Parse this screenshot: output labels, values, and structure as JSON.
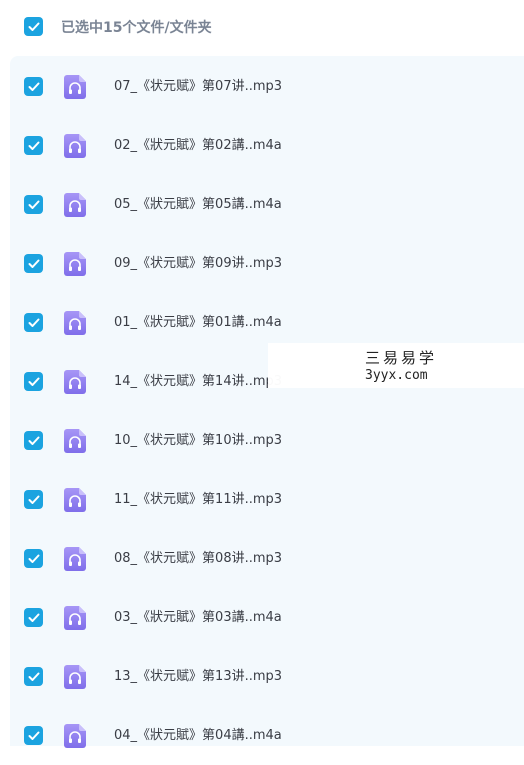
{
  "header": {
    "selection_text": "已选中15个文件/文件夹"
  },
  "files": [
    {
      "name": "07_《状元赋》第07讲..mp3"
    },
    {
      "name": "02_《狀元賦》第02講..m4a"
    },
    {
      "name": "05_《狀元賦》第05講..m4a"
    },
    {
      "name": "09_《状元赋》第09讲..mp3"
    },
    {
      "name": "01_《狀元賦》第01講..m4a"
    },
    {
      "name": "14_《状元赋》第14讲..mp3"
    },
    {
      "name": "10_《状元赋》第10讲..mp3"
    },
    {
      "name": "11_《状元赋》第11讲..mp3"
    },
    {
      "name": "08_《状元赋》第08讲..mp3"
    },
    {
      "name": "03_《狀元賦》第03講..m4a"
    },
    {
      "name": "13_《状元赋》第13讲..mp3"
    },
    {
      "name": "04_《狀元賦》第04講..m4a"
    }
  ],
  "watermark": {
    "line1": "三易易学",
    "line2": "3yyx.com"
  },
  "colors": {
    "accent": "#1ba3e0",
    "audio_icon": "#8c7cf0",
    "list_background": "#f3f9fd"
  },
  "icons": {
    "checkbox": "checkmark-icon",
    "file": "audio-file-headphones-icon"
  }
}
